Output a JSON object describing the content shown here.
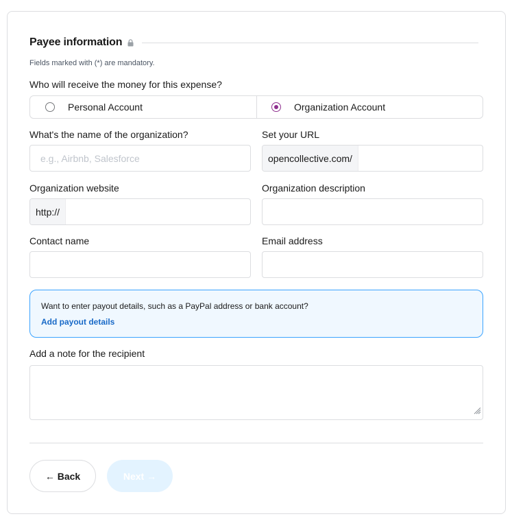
{
  "section": {
    "title": "Payee information",
    "lock_icon": "lock-icon"
  },
  "mandatory_note": "Fields marked with (*) are mandatory.",
  "payee_question": "Who will receive the money for this expense?",
  "payee_options": [
    {
      "label": "Personal Account",
      "checked": false
    },
    {
      "label": "Organization Account",
      "checked": true
    }
  ],
  "fields": {
    "org_name": {
      "label": "What's the name of the organization?",
      "placeholder": "e.g., Airbnb, Salesforce",
      "value": ""
    },
    "url": {
      "label": "Set your URL",
      "prefix": "opencollective.com/",
      "value": ""
    },
    "website": {
      "label": "Organization website",
      "prefix": "http://",
      "value": ""
    },
    "description": {
      "label": "Organization description",
      "value": ""
    },
    "contact": {
      "label": "Contact name",
      "value": ""
    },
    "email": {
      "label": "Email address",
      "value": ""
    }
  },
  "payout_info": {
    "text": "Want to enter payout details, such as a PayPal address or bank account?",
    "link": "Add payout details"
  },
  "note_field": {
    "label": "Add a note for the recipient",
    "value": ""
  },
  "buttons": {
    "back": "← Back",
    "next": "Next →"
  },
  "colors": {
    "accent": "#8e2f8e",
    "link": "#1869c7",
    "info_border": "#3aa3ff",
    "info_bg": "#f0f8ff",
    "next_bg": "#e3f3ff"
  }
}
